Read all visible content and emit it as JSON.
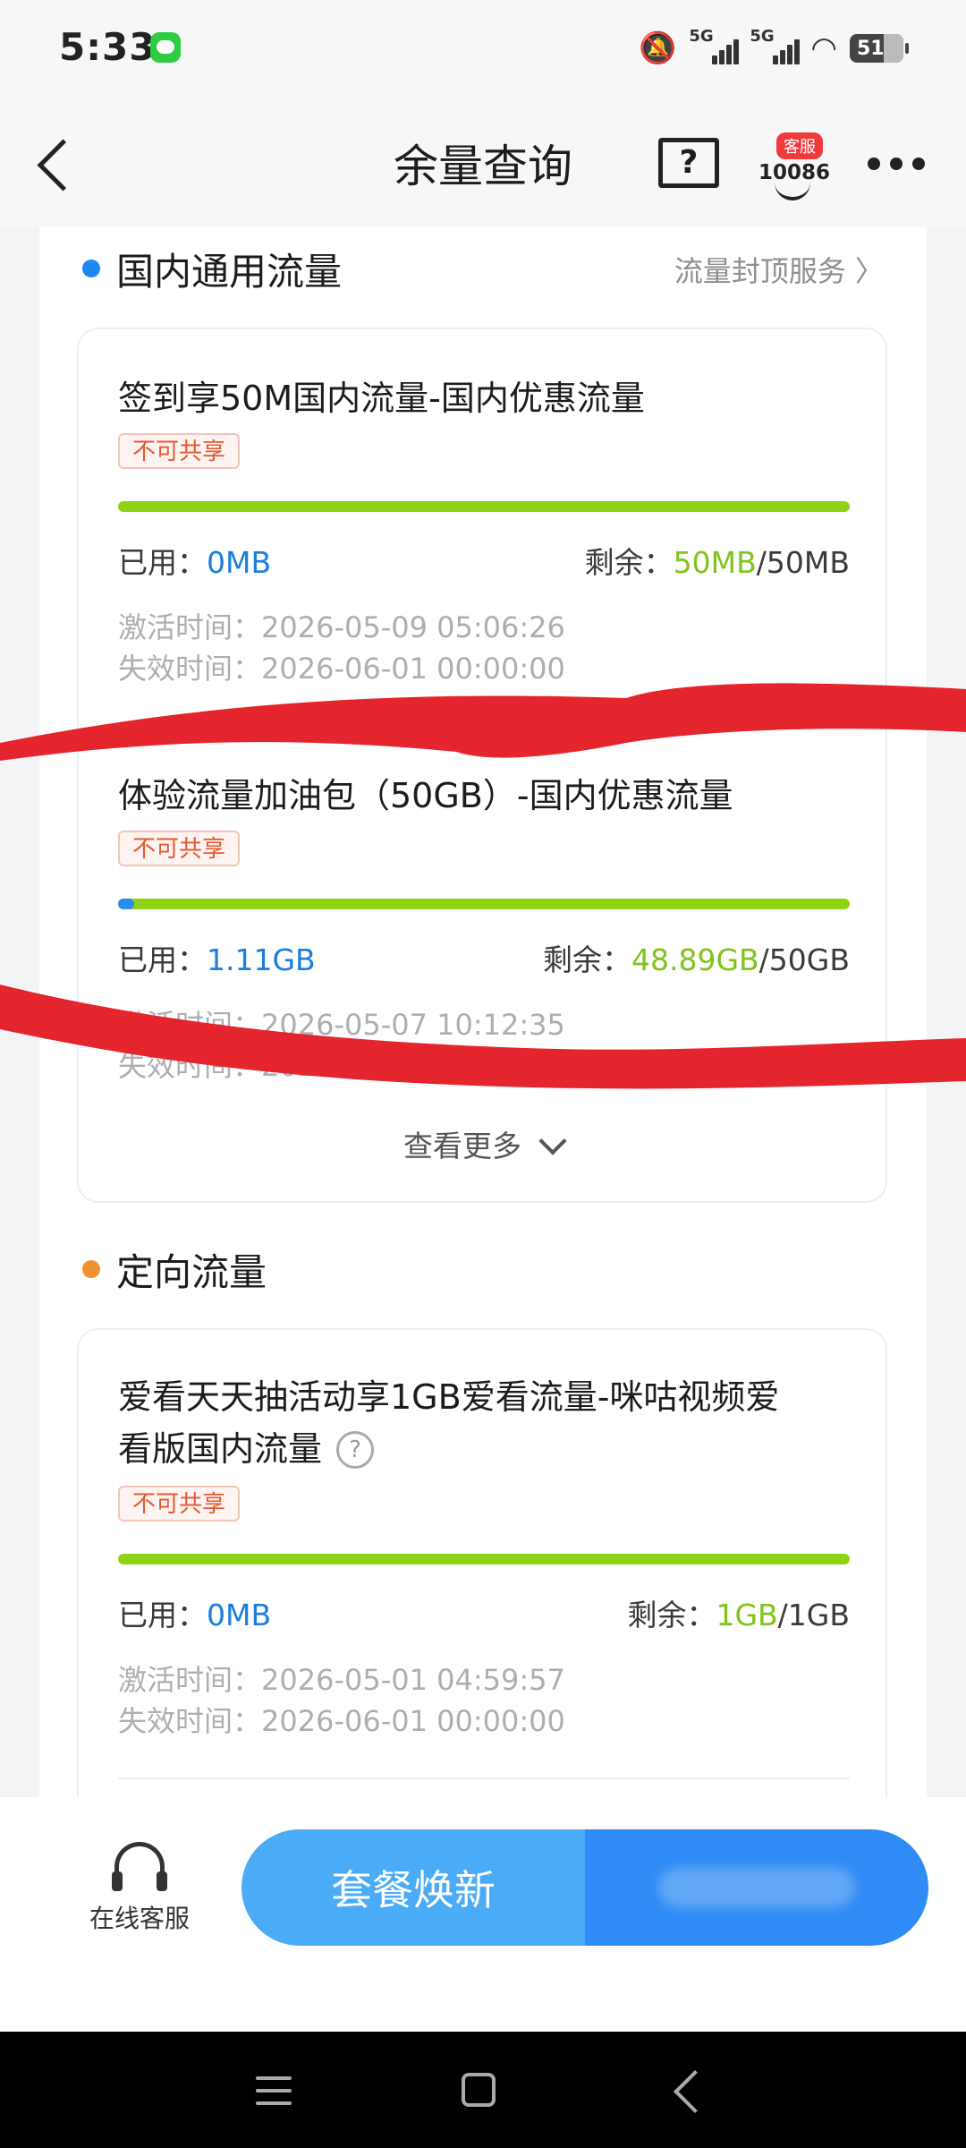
{
  "status_bar": {
    "time": "5:33",
    "battery": "51",
    "signal_1": "5G",
    "signal_2": "5G"
  },
  "header": {
    "title": "余量查询",
    "help_label": "?",
    "cs_badge": "客服",
    "cs_number": "10086"
  },
  "section_general": {
    "title": "国内通用流量",
    "link": "流量封顶服务 〉",
    "items": [
      {
        "name": "签到享50M国内流量-国内优惠流量",
        "tag": "不可共享",
        "used_label": "已用：",
        "used": "0MB",
        "remain_label": "剩余：",
        "remain": "50MB",
        "total": "/50MB",
        "used_fraction": 0,
        "activate": "激活时间：2026-05-09 05:06:26",
        "expire": "失效时间：2026-06-01 00:00:00"
      },
      {
        "name": "体验流量加油包（50GB）-国内优惠流量",
        "tag": "不可共享",
        "used_label": "已用：",
        "used": "1.11GB",
        "remain_label": "剩余：",
        "remain": "48.89GB",
        "total": "/50GB",
        "used_fraction": 0.022,
        "activate": "激活时间：2026-05-07 10:12:35",
        "expire": "失效时间：2026-06-01 00:00:00"
      }
    ],
    "see_more": "查看更多"
  },
  "section_directed": {
    "title": "定向流量",
    "items": [
      {
        "name_line1": "爱看天天抽活动享1GB爱看流量-咪咕视频爱",
        "name_line2": "看版国内流量",
        "tag": "不可共享",
        "used_label": "已用：",
        "used": "0MB",
        "remain_label": "剩余：",
        "remain": "1GB",
        "total": "/1GB",
        "used_fraction": 0,
        "activate": "激活时间：2026-05-01 04:59:57",
        "expire": "失效时间：2026-06-01 00:00:00"
      }
    ]
  },
  "bottom_bar": {
    "online_cs": "在线客服",
    "renew_button": "套餐焕新"
  },
  "colors": {
    "accent_blue": "#2c8cf2",
    "remain_green": "#80c31a",
    "dot_blue": "#1e88f0",
    "dot_orange": "#f0922e",
    "scribble_red": "#e5252e"
  }
}
